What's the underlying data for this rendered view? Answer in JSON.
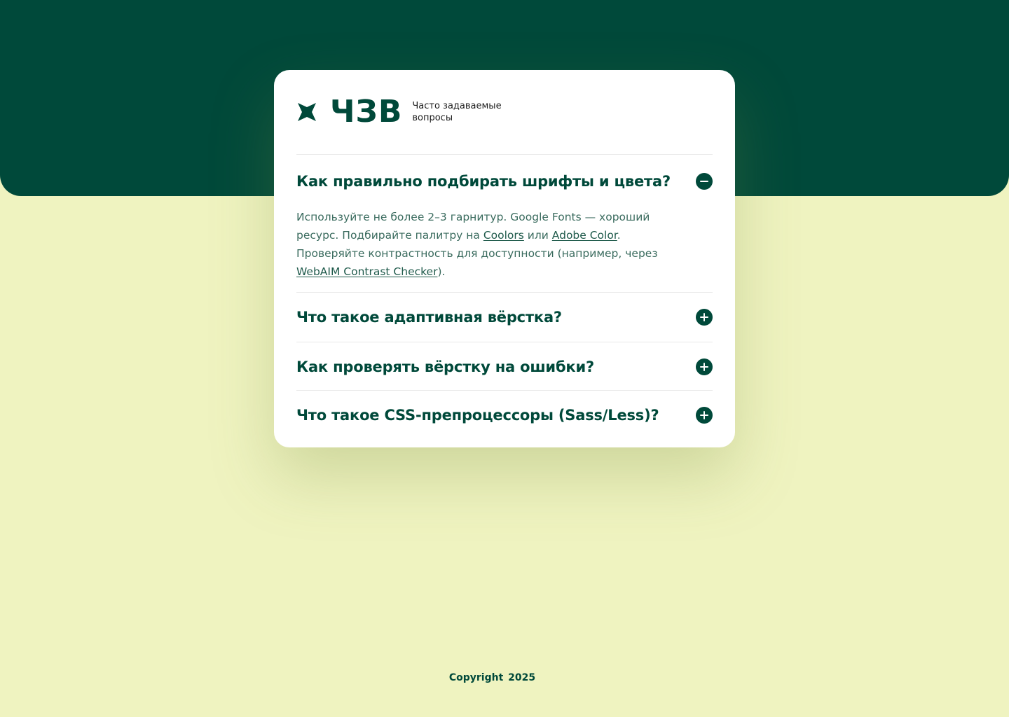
{
  "brand": {
    "name": "ЧЗВ",
    "subtitle_line1": "Часто задаваемые",
    "subtitle_line2": "вопросы",
    "logo_icon": "four-point-star-icon"
  },
  "faq": {
    "items": [
      {
        "question": "Как правильно подбирать шрифты и цвета?",
        "expanded": true,
        "toggle_icon": "minus-circle-icon",
        "answer": {
          "t1": "Используйте не более 2–3 гарнитур. Google Fonts — хороший ресурс. Подбирайте палитру на ",
          "link1": "Coolors",
          "t2": " или ",
          "link2": "Adobe Color",
          "t3": ". Проверяйте контрастность для доступности (например, через ",
          "link3": "WebAIM Contrast Checker",
          "t4": ")."
        }
      },
      {
        "question": "Что такое адаптивная вёрстка?",
        "expanded": false,
        "toggle_icon": "plus-circle-icon"
      },
      {
        "question": "Как проверять вёрстку на ошибки?",
        "expanded": false,
        "toggle_icon": "plus-circle-icon"
      },
      {
        "question": "Что такое CSS-препроцессоры (Sass/Less)?",
        "expanded": false,
        "toggle_icon": "plus-circle-icon"
      }
    ]
  },
  "footer": {
    "copyright": "Copyright",
    "year": "2025"
  },
  "colors": {
    "brand_green": "#00493a",
    "background_light": "#eff3c0",
    "card": "#ffffff",
    "answer_text": "#3a6b5e"
  }
}
